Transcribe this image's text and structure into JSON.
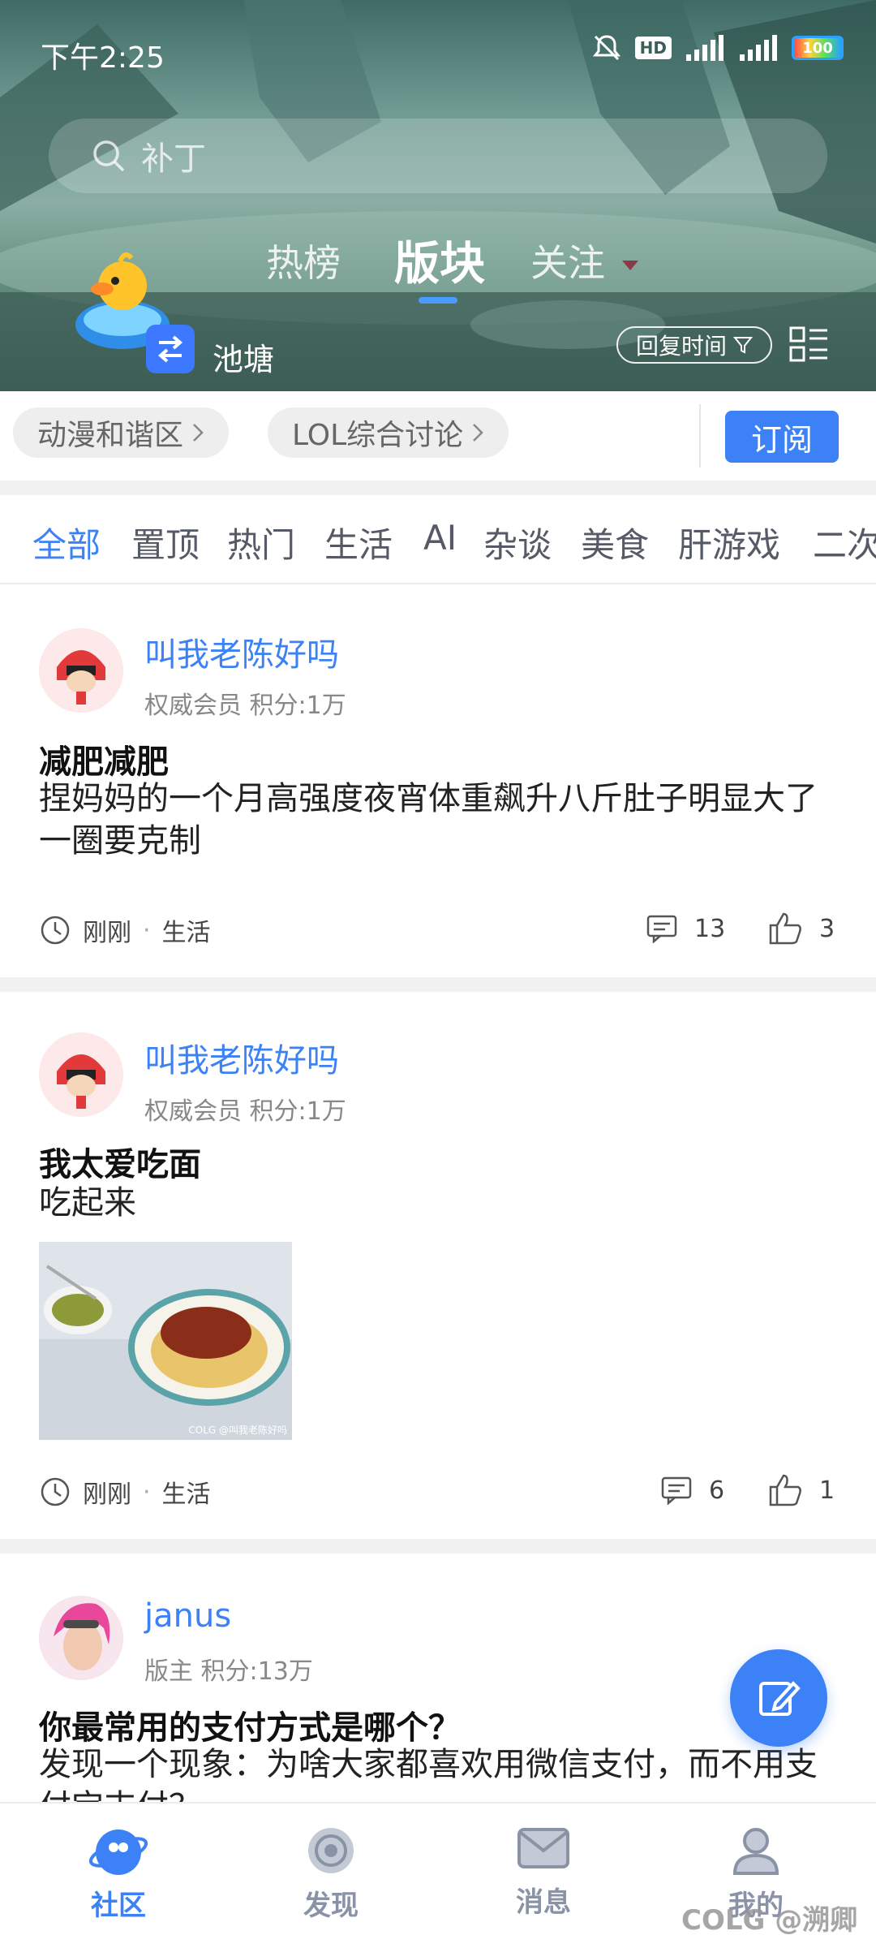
{
  "status_bar": {
    "time": "下午2:25",
    "hd_label": "HD",
    "battery": "100"
  },
  "search": {
    "placeholder": "补丁"
  },
  "top_tabs": [
    {
      "label": "热榜"
    },
    {
      "label": "版块"
    },
    {
      "label": "关注"
    }
  ],
  "forum": {
    "name": "池塘",
    "sort_label": "回复时间"
  },
  "chips": [
    {
      "label": "动漫和谐区"
    },
    {
      "label": "LOL综合讨论"
    }
  ],
  "subscribe_label": "订阅",
  "filters": [
    "全部",
    "置顶",
    "热门",
    "生活",
    "AI",
    "杂谈",
    "美食",
    "肝游戏",
    "二次"
  ],
  "posts": [
    {
      "username": "叫我老陈好吗",
      "role": "权威会员  积分:1万",
      "title": "减肥减肥",
      "body": "捏妈妈的一个月高强度夜宵体重飙升八斤肚子明显大了一圈要克制",
      "time": "刚刚",
      "category": "生活",
      "comments": "13",
      "likes": "3"
    },
    {
      "username": "叫我老陈好吗",
      "role": "权威会员  积分:1万",
      "title": "我太爱吃面",
      "body": "吃起来",
      "image_watermark": "COLG @叫我老陈好吗",
      "time": "刚刚",
      "category": "生活",
      "comments": "6",
      "likes": "1"
    },
    {
      "username": "janus",
      "role": "版主  积分:13万",
      "title": "你最常用的支付方式是哪个？",
      "body": "发现一个现象：为啥大家都喜欢用微信支付，而不用支付宝支付？"
    }
  ],
  "bottom_nav": [
    {
      "label": "社区",
      "icon": "community-icon"
    },
    {
      "label": "发现",
      "icon": "discover-icon"
    },
    {
      "label": "消息",
      "icon": "message-icon"
    },
    {
      "label": "我的",
      "icon": "profile-icon"
    }
  ],
  "watermark": "COLG @溯卿",
  "colors": {
    "accent": "#3c82f6",
    "username": "#3c82f6"
  }
}
